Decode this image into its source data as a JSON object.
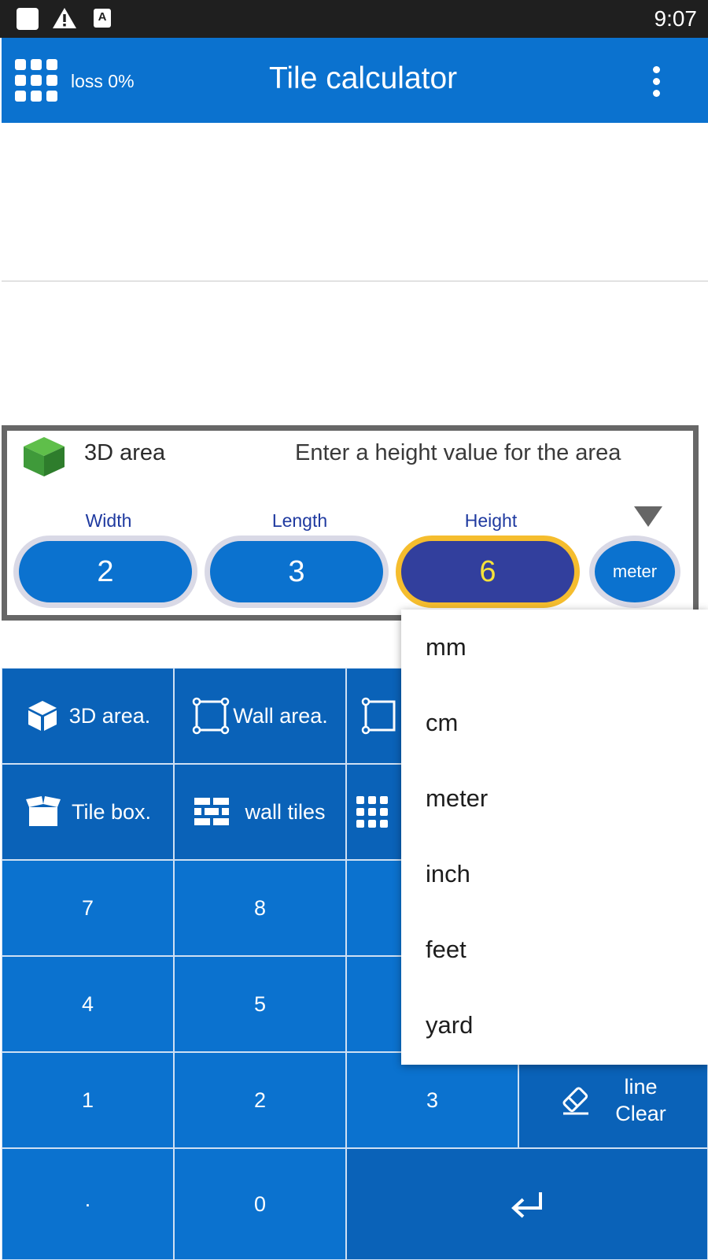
{
  "status_bar": {
    "time": "9:07",
    "icons": [
      "square-icon",
      "warning-icon",
      "font-a-icon"
    ]
  },
  "app_bar": {
    "menu_icon": "grid-icon",
    "loss": "loss 0%",
    "title": "Tile calculator",
    "overflow_icon": "kebab-menu-icon"
  },
  "panel": {
    "icon": "cube-icon",
    "label": "3D area",
    "hint": "Enter a height value for the area",
    "fields": [
      {
        "label": "Width",
        "value": "2"
      },
      {
        "label": "Length",
        "value": "3"
      },
      {
        "label": "Height",
        "value": "6"
      }
    ],
    "unit": "meter"
  },
  "keypad": {
    "row1": [
      "3D area.",
      "Wall area.",
      ""
    ],
    "row2": [
      "Tile box.",
      "wall tiles",
      ""
    ],
    "digits": [
      "7",
      "8",
      "4",
      "5",
      "1",
      "2",
      "3",
      "·",
      "0"
    ],
    "clear_line1": "line",
    "clear_line2": "Clear",
    "enter_icon": "enter-return-icon"
  },
  "unit_dropdown": {
    "options": [
      "mm",
      "cm",
      "meter",
      "inch",
      "feet",
      "yard"
    ]
  },
  "colors": {
    "primary": "#0b72cf",
    "active_field": "#323f9d",
    "active_border": "#f5bd2e",
    "active_text": "#f5e23a",
    "cube_green": "#3f9a3a"
  }
}
